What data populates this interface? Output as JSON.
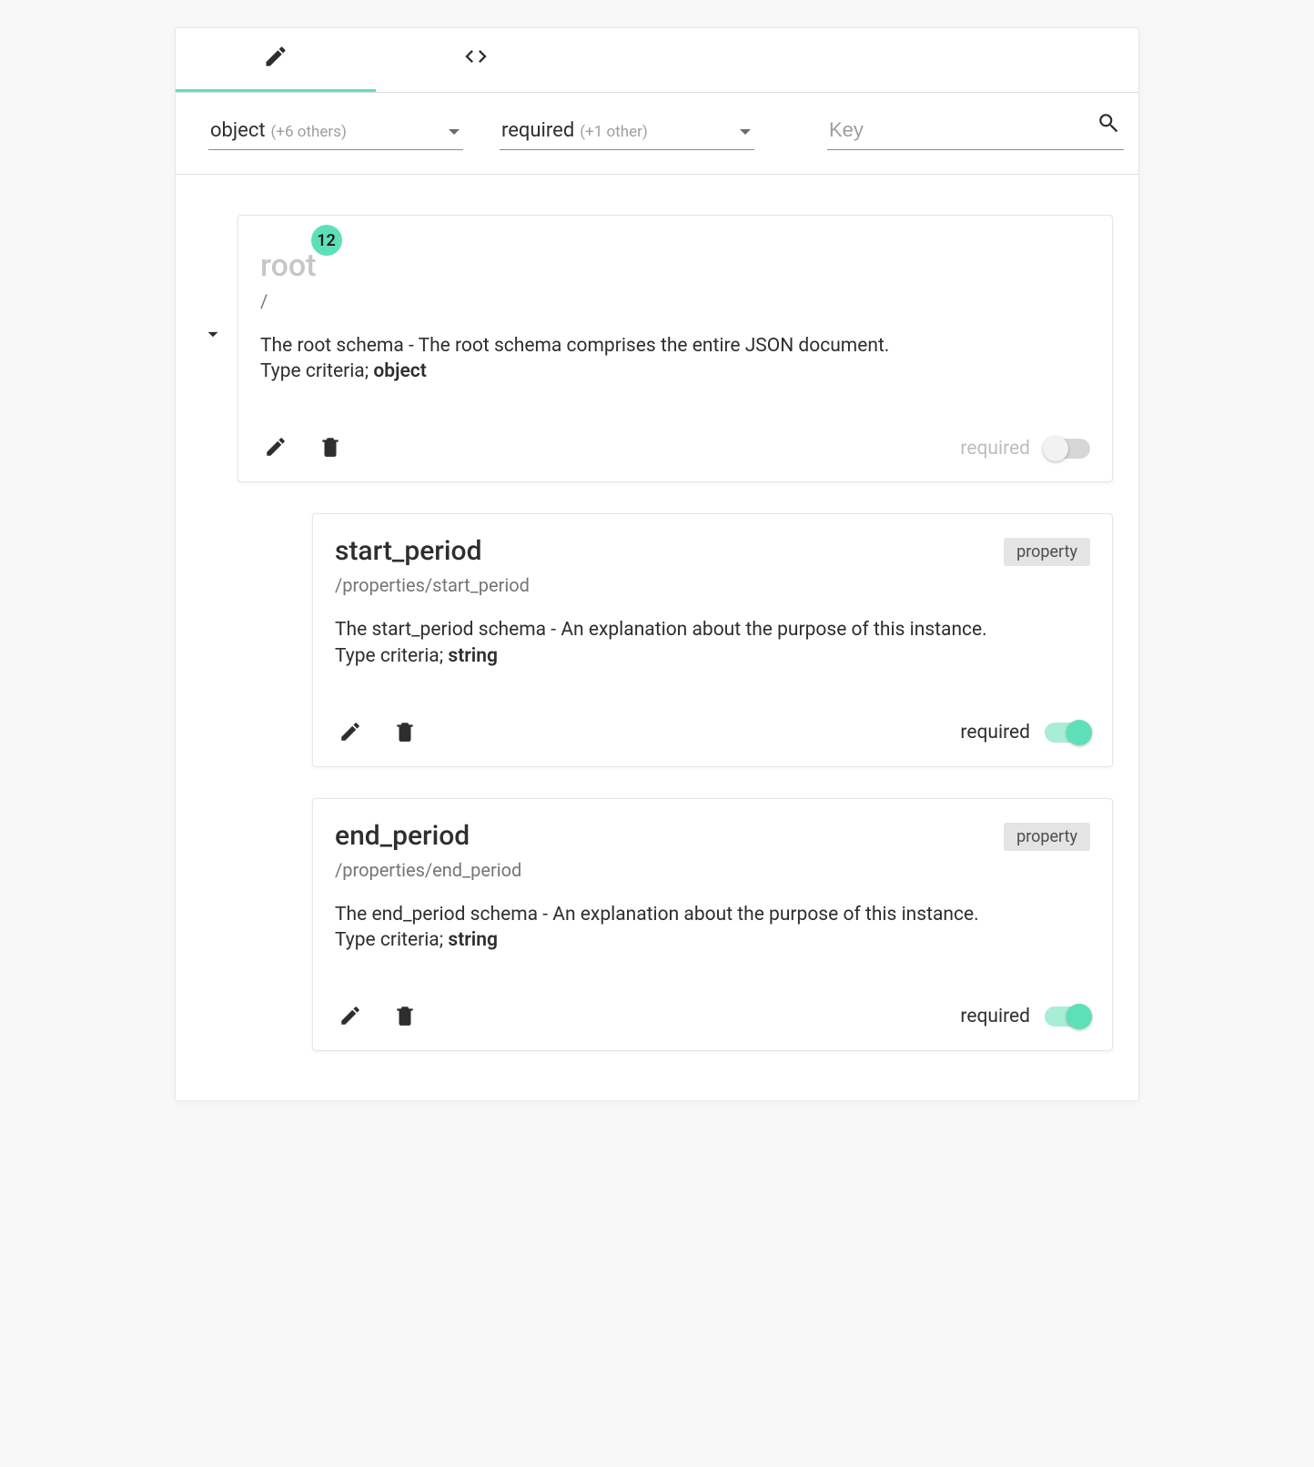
{
  "filters": {
    "type_select": {
      "main": "object",
      "extra": "(+6 others)"
    },
    "required_select": {
      "main": "required",
      "extra": "(+1 other)"
    },
    "key_placeholder": "Key"
  },
  "labels": {
    "required": "required",
    "type_prefix": "Type criteria; ",
    "property_chip": "property"
  },
  "root": {
    "title": "root",
    "badge": "12",
    "path": "/",
    "description": "The root schema - The root schema comprises the entire JSON document.",
    "type": "object",
    "required_on": false
  },
  "properties": [
    {
      "title": "start_period",
      "path": "/properties/start_period",
      "description": "The start_period schema - An explanation about the purpose of this instance.",
      "type": "string",
      "required_on": true
    },
    {
      "title": "end_period",
      "path": "/properties/end_period",
      "description": "The end_period schema - An explanation about the purpose of this instance.",
      "type": "string",
      "required_on": true
    }
  ]
}
